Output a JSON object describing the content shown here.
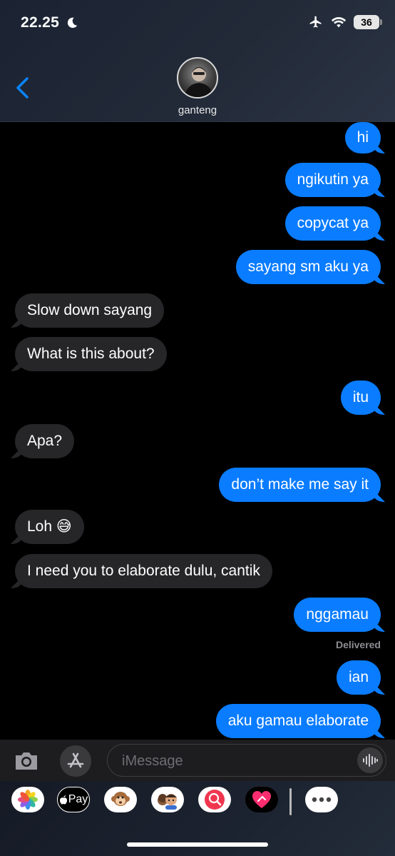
{
  "status_bar": {
    "time": "22.25",
    "battery": "36"
  },
  "header": {
    "contact_name": "ganteng"
  },
  "messages": [
    {
      "text": "hi",
      "direction": "out"
    },
    {
      "text": "ngikutin ya",
      "direction": "out"
    },
    {
      "text": "copycat ya",
      "direction": "out"
    },
    {
      "text": "sayang sm aku ya",
      "direction": "out"
    },
    {
      "text": "Slow down sayang",
      "direction": "in"
    },
    {
      "text": "What is this about?",
      "direction": "in"
    },
    {
      "text": "itu",
      "direction": "out"
    },
    {
      "text": "Apa?",
      "direction": "in"
    },
    {
      "text": "don’t make me say it",
      "direction": "out"
    },
    {
      "text": "Loh 😅",
      "direction": "in"
    },
    {
      "text": "I need you to elaborate dulu, cantik",
      "direction": "in"
    },
    {
      "text": "nggamau",
      "direction": "out"
    },
    {
      "text": "ian",
      "direction": "out"
    },
    {
      "text": "aku gamau elaborate",
      "direction": "out"
    }
  ],
  "delivered_label": "Delivered",
  "input": {
    "placeholder": "iMessage"
  },
  "drawer": {
    "apple_pay_label": "Pay"
  },
  "colors": {
    "outgoing": "#0a7cff",
    "incoming": "#262628",
    "background": "#000000"
  }
}
